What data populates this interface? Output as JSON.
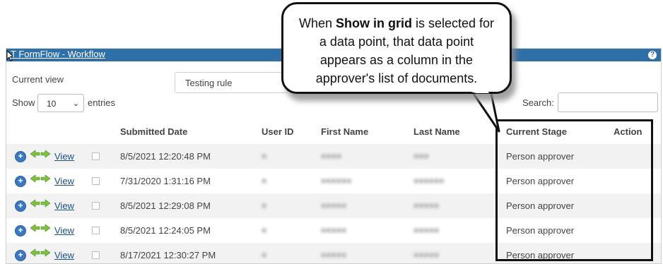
{
  "app": {
    "title": "T FormFlow - Workflow",
    "help_label": "?"
  },
  "controls": {
    "current_view_label": "Current view",
    "current_view_value": "Testing rule",
    "show_label": "Show",
    "entries_value": "10",
    "entries_label": "entries",
    "search_label": "Search:"
  },
  "table": {
    "columns": [
      "Submitted Date",
      "User ID",
      "First Name",
      "Last Name",
      "Current Stage",
      "Action"
    ],
    "rows": [
      {
        "view": "View",
        "date": "8/5/2021 12:20:48 PM",
        "stage": "Person approver"
      },
      {
        "view": "View",
        "date": "7/31/2020 1:31:16 PM",
        "stage": "Person approver"
      },
      {
        "view": "View",
        "date": "8/5/2021 12:29:08 PM",
        "stage": "Person approver"
      },
      {
        "view": "View",
        "date": "8/5/2021 12:24:05 PM",
        "stage": "Person approver"
      },
      {
        "view": "View",
        "date": "8/17/2021 12:30:27 PM",
        "stage": "Person approver"
      }
    ]
  },
  "callout": {
    "before": "When ",
    "bold": "Show in grid",
    "after": " is selected for a data point, that data point appears as a column in the approver's list of documents."
  },
  "colors": {
    "titlebar": "#2f6fa8",
    "link": "#1a4f8b",
    "arrow": "#7cc142",
    "plus": "#3b78c0"
  },
  "icons": {
    "row_plus": "plus-circle-icon",
    "row_arrows": "route-arrows-icon",
    "help": "help-icon"
  }
}
